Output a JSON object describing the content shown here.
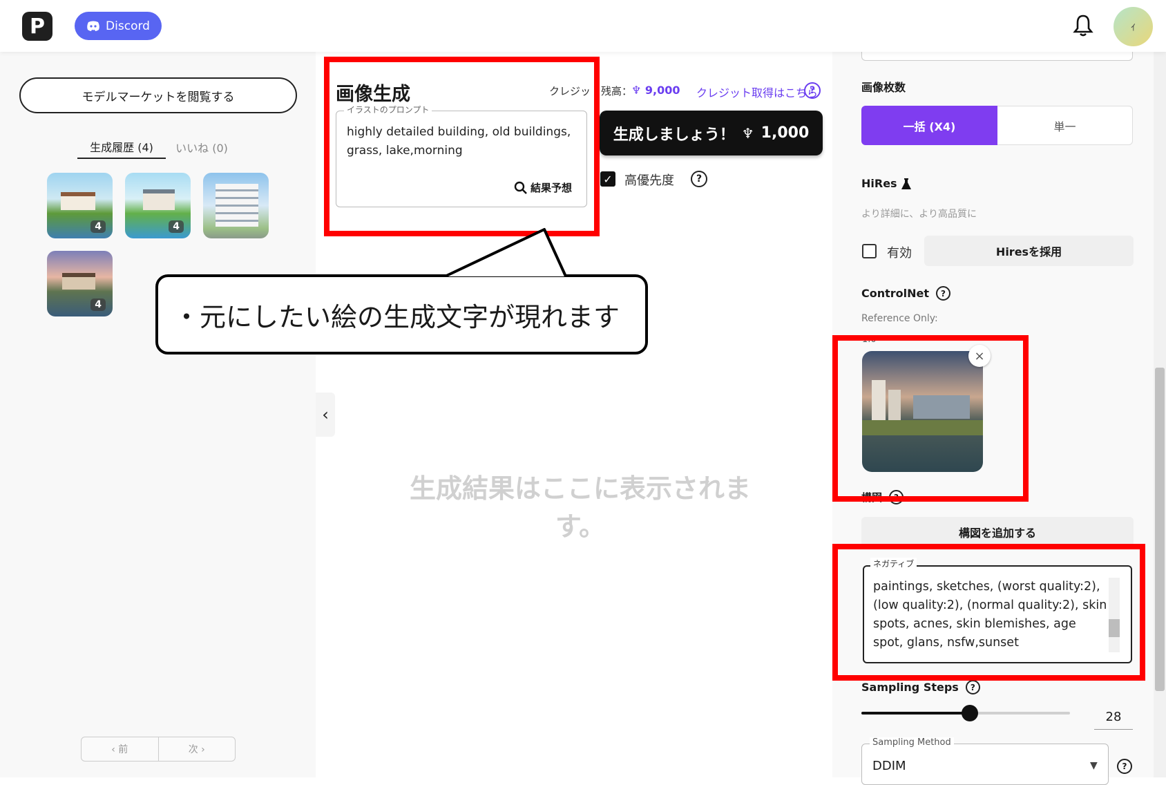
{
  "header": {
    "logo_letter": "P",
    "discord_label": "Discord",
    "avatar_initial": "ｲ"
  },
  "sidebar": {
    "market_button": "モデルマーケットを閲覧する",
    "tabs": [
      {
        "label": "生成履歴 (4)",
        "active": true
      },
      {
        "label": "いいね (0)",
        "active": false
      }
    ],
    "history_badges": [
      "4",
      "4",
      "4",
      "4"
    ],
    "pager": {
      "prev": "‹ 前",
      "next": "次 ›"
    }
  },
  "generate": {
    "title": "画像生成",
    "credit_label": "クレジット残高：",
    "credit_amount": "9,000",
    "credit_link": "クレジット取得はこちら",
    "prompt_legend": "イラストのプロンプト",
    "prompt_text": "highly detailed building, old buildings, grass, lake,morning",
    "predict_label": "結果予想",
    "button_label": "生成しましょう！",
    "button_cost": "1,000",
    "priority_label": "高優先度",
    "priority_checked": true,
    "placeholder": "生成結果はここに表示されます。"
  },
  "callout": {
    "text": "・元にしたい絵の生成文字が現れます"
  },
  "settings": {
    "image_count_label": "画像枚数",
    "count_options": [
      {
        "label": "一括 (X4)",
        "selected": true
      },
      {
        "label": "単一",
        "selected": false
      }
    ],
    "hires_label": "HiRes",
    "hires_desc": "より詳細に、より高品質に",
    "hires_enable_label": "有効",
    "hires_apply": "Hiresを採用",
    "controlnet_label": "ControlNet",
    "controlnet_ref": "Reference Only:",
    "controlnet_weight": "1.0",
    "composition_label": "構図",
    "composition_add": "構図を追加する",
    "negative_legend": "ネガティブ",
    "negative_text": "paintings, sketches, (worst quality:2), (low quality:2), (normal quality:2), skin spots, acnes, skin blemishes, age spot, glans, nsfw,sunset",
    "steps_label": "Sampling Steps",
    "steps_value": "28",
    "steps_fraction": 0.52,
    "method_legend": "Sampling Method",
    "method_value": "DDIM"
  },
  "colors": {
    "accent_purple": "#7f3df0",
    "discord": "#5865f2",
    "highlight_red": "#ff0000"
  }
}
